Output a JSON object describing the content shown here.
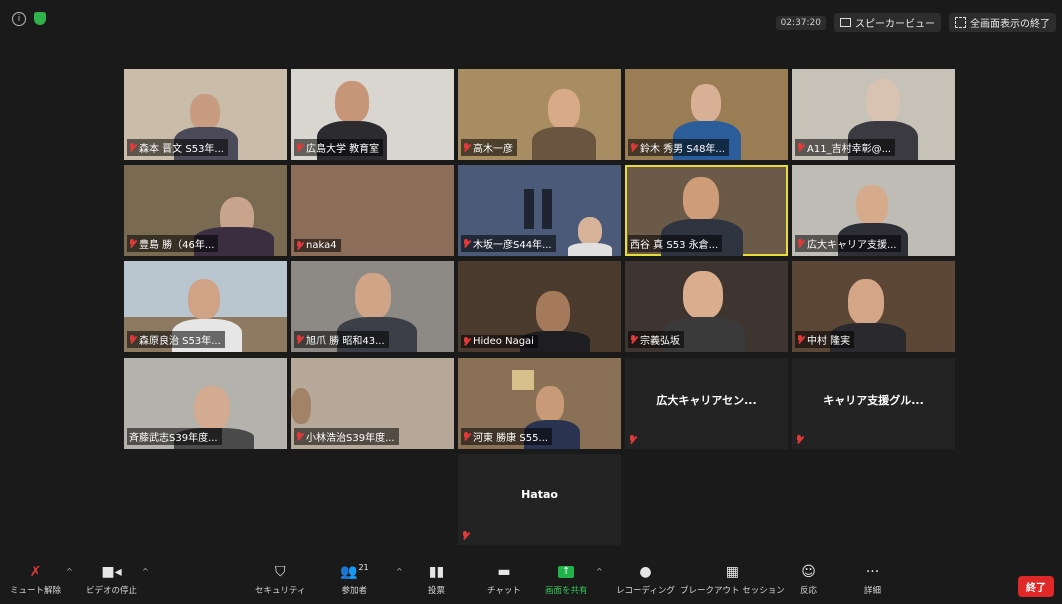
{
  "topbar": {
    "timer": "02:37:20",
    "speaker_view_label": "スピーカービュー",
    "exit_fullscreen_label": "全画面表示の終了"
  },
  "tiles": [
    {
      "name": "森本 晋文 S53年...",
      "bg": "#c9bca8"
    },
    {
      "name": "広島大学 教育室",
      "bg": "#d9d6cf"
    },
    {
      "name": "高木一彦",
      "bg": "#a88c62"
    },
    {
      "name": "鈴木 秀男 S48年...",
      "bg": "#9b7d55"
    },
    {
      "name": "A11_吉村幸彰@...",
      "bg": "#c7c2b8"
    },
    {
      "name": "豊島 勝（46年...",
      "bg": "#7a6a52"
    },
    {
      "name": "naka4",
      "bg": "#8c6d5a"
    },
    {
      "name": "木坂一彦S44年...",
      "bg": "#4a5a78"
    },
    {
      "name": "西谷 真 S53 永倉...",
      "bg": "#6b5a48"
    },
    {
      "name": "広大キャリア支援...",
      "bg": "#bfbcb5"
    },
    {
      "name": "森原良治 S53年...",
      "bg": "#b9c6cf"
    },
    {
      "name": "旭爪 勝 昭和43...",
      "bg": "#8d8a85"
    },
    {
      "name": "Hideo Nagai",
      "bg": "#4b3a2e"
    },
    {
      "name": "宗義弘坂",
      "bg": "#3e3430"
    },
    {
      "name": "中村 隆実",
      "bg": "#5c4636"
    },
    {
      "name": "斉藤武志S39年度...",
      "bg": "#b3b2ac"
    },
    {
      "name": "小林浩治S39年度...",
      "bg": "#b6a999"
    },
    {
      "name": "河東 勝康 S55...",
      "bg": "#8a7156"
    },
    {
      "name": "広大キャリアセン...",
      "bg": ""
    },
    {
      "name": "キャリア支援グル...",
      "bg": ""
    },
    {
      "name": "Hatao",
      "bg": ""
    }
  ],
  "toolbar": {
    "unmute": "ミュート解除",
    "stop_video": "ビデオの停止",
    "security": "セキュリティ",
    "participants": "参加者",
    "participants_count": "21",
    "polls": "投票",
    "chat": "チャット",
    "share_screen": "画面を共有",
    "record": "レコーディング",
    "breakout": "ブレークアウト セッション",
    "reactions": "反応",
    "more": "詳細",
    "end": "終了"
  }
}
